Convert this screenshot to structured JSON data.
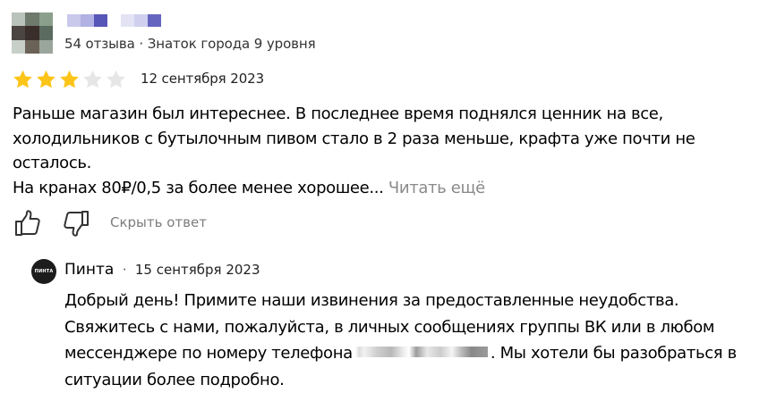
{
  "author": {
    "avatar_colors": [
      "#b9c2bb",
      "#6d7a6c",
      "#8aa08c",
      "#4a4540",
      "#3a2e2a",
      "#5c6b60",
      "#c7d0c8",
      "#6b6257",
      "#9aa69b"
    ],
    "name_blur_colors": [
      "#c9c9ec",
      "#b1b1e4",
      "#5656b8",
      "#ffffff",
      "#e3e3f5",
      "#d0d0ee",
      "#6565c0"
    ],
    "meta": "54 отзыва · Знаток города 9 уровня"
  },
  "review": {
    "rating": 3,
    "rating_max": 5,
    "star_color": "#fcc419",
    "star_empty_color": "#e6e6e6",
    "date": "12 сентября 2023",
    "lines": [
      "Раньше магазин был интереснее. В последнее время поднялся ценник на все,",
      "холодильников с бутылочным пивом стало в 2 раза меньше, крафта уже почти не",
      "осталось."
    ],
    "last_line": "На кранах 80₽/0,5 за более менее хорошее...",
    "read_more": "Читать ещё"
  },
  "actions": {
    "like_icon": "thumbs-up-icon",
    "dislike_icon": "thumbs-down-icon",
    "hide_reply": "Скрыть ответ"
  },
  "reply": {
    "org_logo_text": "ПИНТА",
    "org_name": "Пинта",
    "separator": "·",
    "date": "15 сентября 2023",
    "line1": "Добрый день! Примите наши извинения за предоставленные неудобства.",
    "line2": "Свяжитесь с нами, пожалуйста, в личных сообщениях группы ВК или в любом",
    "line3_before": "мессенджере по номеру телефона",
    "line3_after": ". Мы хотели бы разобраться в",
    "line4": "ситуации более подробно."
  }
}
